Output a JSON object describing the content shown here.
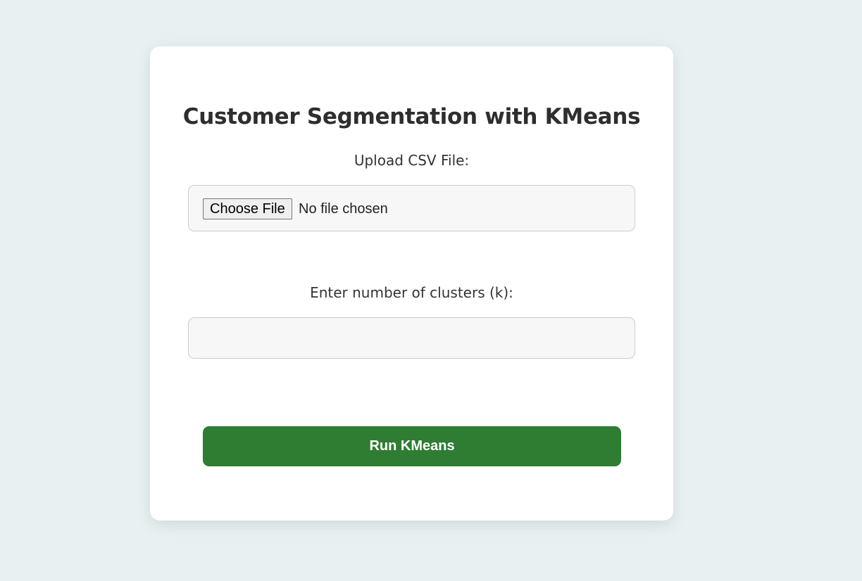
{
  "form": {
    "title": "Customer Segmentation with KMeans",
    "upload_label": "Upload CSV File:",
    "file_input": {
      "button_label": "Choose File",
      "status_text": "No file chosen"
    },
    "clusters_label": "Enter number of clusters (k):",
    "clusters_input": {
      "value": ""
    },
    "submit_label": "Run KMeans"
  },
  "colors": {
    "page_background": "#e8f1f2",
    "card_background": "#ffffff",
    "field_background": "#f7f7f7",
    "accent_button": "#2e7d32"
  }
}
